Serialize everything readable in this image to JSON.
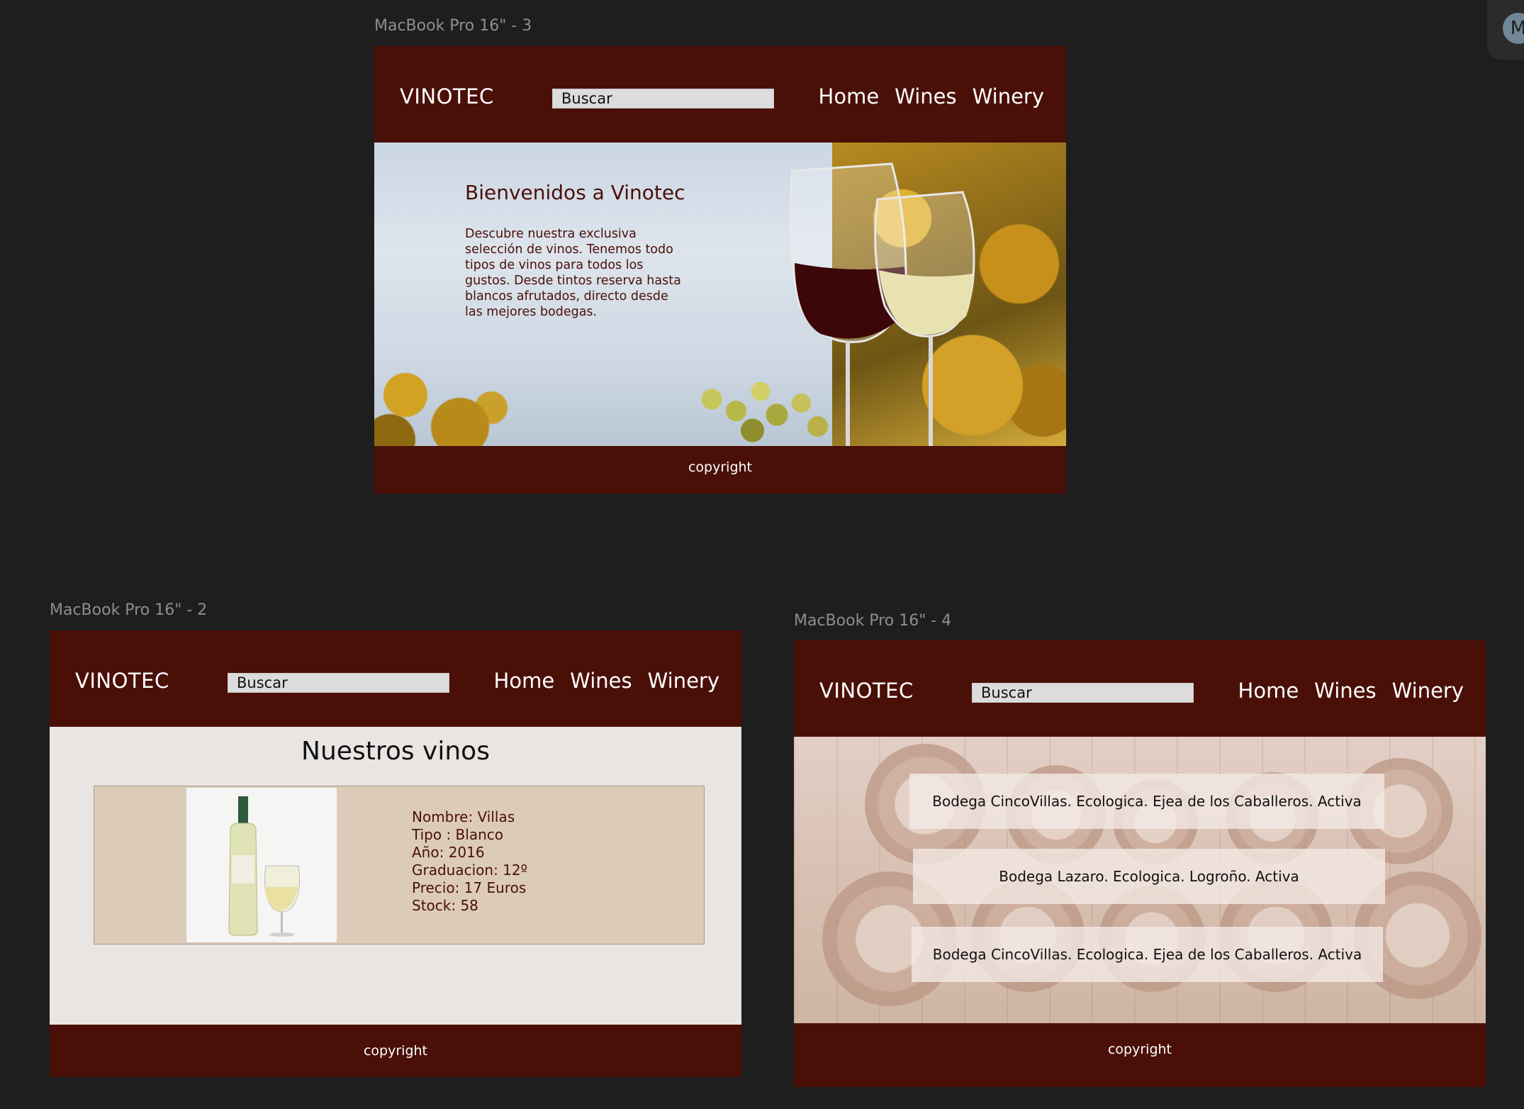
{
  "frames": [
    {
      "label": "MacBook Pro 16\" - 3"
    },
    {
      "label": "MacBook Pro 16\" - 2"
    },
    {
      "label": "MacBook Pro 16\" - 4"
    }
  ],
  "header": {
    "logo": "VINOTEC",
    "search_placeholder": "Buscar",
    "nav": [
      "Home",
      "Wines",
      "Winery"
    ]
  },
  "footer": {
    "text": "copyright"
  },
  "home": {
    "title": "Bienvenidos a Vinotec",
    "text": "Descubre nuestra exclusiva selección de vinos. Tenemos todo tipos de vinos para todos los gustos. Desde tintos reserva hasta blancos afrutados, directo desde las mejores bodegas."
  },
  "wines": {
    "title": "Nuestros vinos",
    "item": {
      "nombre": "Nombre: Villas",
      "tipo": "Tipo : Blanco",
      "anio": "Año: 2016",
      "graduacion": "Graduacion: 12º",
      "precio": "Precio: 17 Euros",
      "stock": "Stock: 58"
    }
  },
  "winery": {
    "items": [
      "Bodega CincoVillas. Ecologica. Ejea de los Caballeros. Activa",
      "Bodega Lazaro. Ecologica. Logroño. Activa",
      "Bodega CincoVillas. Ecologica. Ejea de los Caballeros. Activa"
    ]
  },
  "user": {
    "avatar_initial": "M"
  },
  "colors": {
    "brand": "#4a1008",
    "canvas": "#1e1e1e",
    "card": "#dccbb8"
  }
}
